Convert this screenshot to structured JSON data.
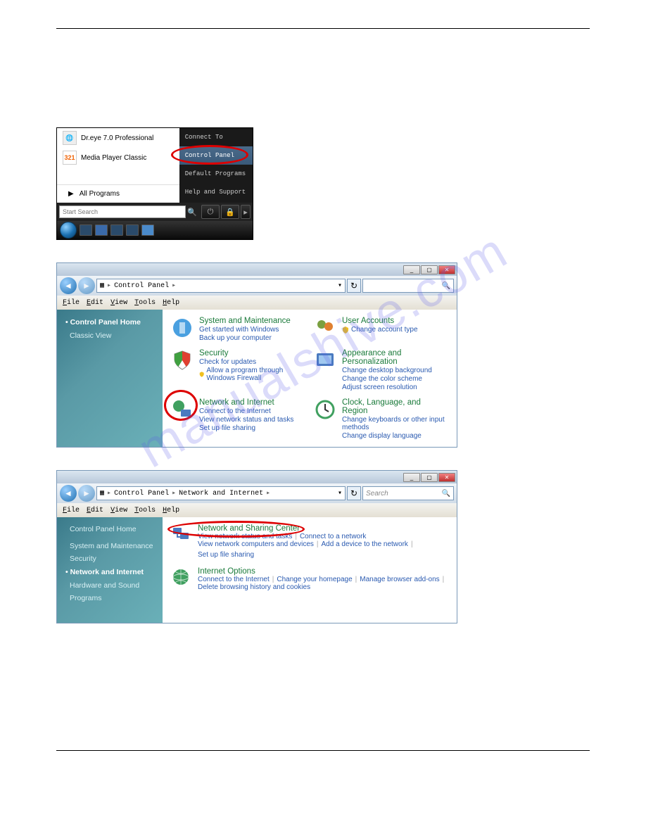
{
  "watermark_text": "manualshive.com",
  "startmenu": {
    "left_items": [
      {
        "icon": "globe",
        "label": "Dr.eye 7.0 Professional"
      },
      {
        "icon": "mpc",
        "label": "Media Player Classic"
      }
    ],
    "all_programs": "All Programs",
    "search_placeholder": "Start Search",
    "right_items": [
      {
        "label": "Connect To",
        "selected": false
      },
      {
        "label": "Control Panel",
        "selected": true
      },
      {
        "label": "Default Programs",
        "selected": false
      },
      {
        "label": "Help and Support",
        "selected": false
      }
    ]
  },
  "win1": {
    "breadcrumb": [
      "Control Panel"
    ],
    "search_placeholder": "",
    "menus": [
      "File",
      "Edit",
      "View",
      "Tools",
      "Help"
    ],
    "sidebar": {
      "home": "Control Panel Home",
      "classic": "Classic View"
    },
    "categories": {
      "sys": {
        "title": "System and Maintenance",
        "links": [
          "Get started with Windows",
          "Back up your computer"
        ]
      },
      "sec": {
        "title": "Security",
        "links": [
          "Check for updates"
        ],
        "shield_link": "Allow a program through Windows Firewall"
      },
      "net": {
        "title": "Network and Internet",
        "links": [
          "Connect to the Internet",
          "View network status and tasks",
          "Set up file sharing"
        ]
      },
      "usr": {
        "title": "User Accounts",
        "shield_link": "Change account type"
      },
      "app": {
        "title": "Appearance and Personalization",
        "links": [
          "Change desktop background",
          "Change the color scheme",
          "Adjust screen resolution"
        ]
      },
      "clk": {
        "title": "Clock, Language, and Region",
        "links": [
          "Change keyboards or other input methods",
          "Change display language"
        ]
      }
    }
  },
  "win2": {
    "breadcrumb": [
      "Control Panel",
      "Network and Internet"
    ],
    "search_placeholder": "Search",
    "menus": [
      "File",
      "Edit",
      "View",
      "Tools",
      "Help"
    ],
    "sidebar": {
      "home": "Control Panel Home",
      "items": [
        "System and Maintenance",
        "Security",
        "Network and Internet",
        "Hardware and Sound",
        "Programs"
      ],
      "active_index": 2
    },
    "nsc": {
      "title": "Network and Sharing Center",
      "links": [
        "View network status and tasks",
        "Connect to a network",
        "View network computers and devices",
        "Add a device to the network",
        "Set up file sharing"
      ]
    },
    "io": {
      "title": "Internet Options",
      "links": [
        "Connect to the Internet",
        "Change your homepage",
        "Manage browser add-ons",
        "Delete browsing history and cookies"
      ]
    }
  }
}
